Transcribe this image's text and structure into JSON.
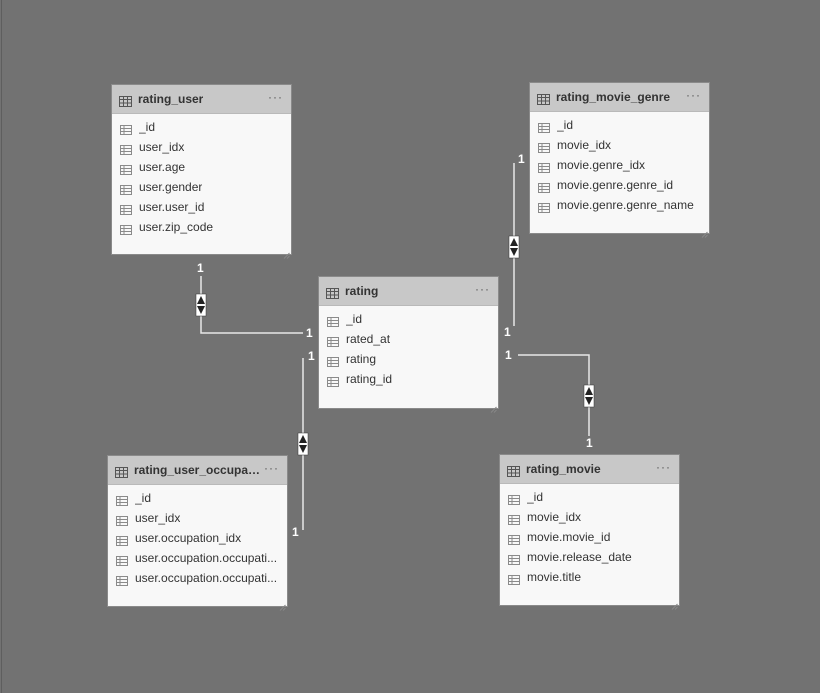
{
  "tables": [
    {
      "name": "rating_user",
      "fields": [
        "_id",
        "user_idx",
        "user.age",
        "user.gender",
        "user.user_id",
        "user.zip_code"
      ]
    },
    {
      "name": "rating_movie_genre",
      "fields": [
        "_id",
        "movie_idx",
        "movie.genre_idx",
        "movie.genre.genre_id",
        "movie.genre.genre_name"
      ]
    },
    {
      "name": "rating",
      "fields": [
        "_id",
        "rated_at",
        "rating",
        "rating_id"
      ]
    },
    {
      "name": "rating_user_occupati...",
      "fields": [
        "_id",
        "user_idx",
        "user.occupation_idx",
        "user.occupation.occupati...",
        "user.occupation.occupati..."
      ]
    },
    {
      "name": "rating_movie",
      "fields": [
        "_id",
        "movie_idx",
        "movie.movie_id",
        "movie.release_date",
        "movie.title"
      ]
    }
  ],
  "table_menu_glyph": "···",
  "icons": {
    "table": "table-icon",
    "column": "column-icon",
    "filter": "bidirectional-filter-icon",
    "resize": "resize-grip-icon"
  },
  "relationships": [
    {
      "from": "rating_user",
      "to": "rating",
      "from_cardinality": "1",
      "to_cardinality": "1",
      "cross_filter": "both"
    },
    {
      "from": "rating_movie_genre",
      "to": "rating",
      "from_cardinality": "1",
      "to_cardinality": "1",
      "cross_filter": "both"
    },
    {
      "from": "rating_user_occupati...",
      "to": "rating",
      "from_cardinality": "1",
      "to_cardinality": "1",
      "cross_filter": "both"
    },
    {
      "from": "rating_movie",
      "to": "rating",
      "from_cardinality": "1",
      "to_cardinality": "1",
      "cross_filter": "both"
    }
  ],
  "colors": {
    "canvas": "#727272",
    "card": "#f8f8f8",
    "card_header": "#c8c8c8",
    "line": "#e8e8e8"
  }
}
